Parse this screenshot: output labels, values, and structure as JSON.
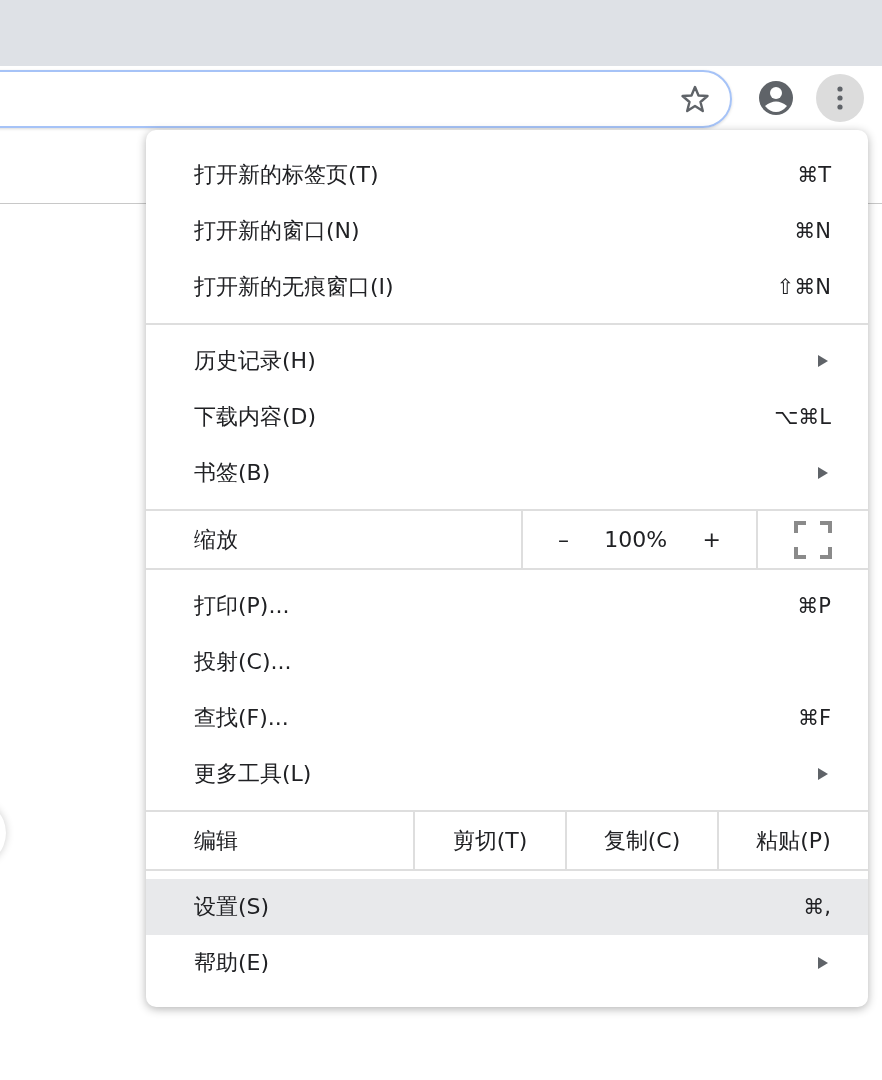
{
  "toolbar": {
    "address_bar": {
      "focused": true
    },
    "menu_button": {
      "pressed": true
    }
  },
  "menu": {
    "groups": [
      {
        "items": [
          {
            "kind": "item",
            "label": "打开新的标签页(T)",
            "shortcut": "⌘T",
            "submenu": false,
            "selected": false
          },
          {
            "kind": "item",
            "label": "打开新的窗口(N)",
            "shortcut": "⌘N",
            "submenu": false,
            "selected": false
          },
          {
            "kind": "item",
            "label": "打开新的无痕窗口(I)",
            "shortcut": "⇧⌘N",
            "submenu": false,
            "selected": false
          }
        ]
      },
      {
        "items": [
          {
            "kind": "item",
            "label": "历史记录(H)",
            "submenu": true,
            "selected": false
          },
          {
            "kind": "item",
            "label": "下载内容(D)",
            "shortcut": "⌥⌘L",
            "submenu": false,
            "selected": false
          },
          {
            "kind": "item",
            "label": "书签(B)",
            "submenu": true,
            "selected": false
          }
        ]
      },
      {
        "items": [
          {
            "kind": "zoom",
            "label": "缩放",
            "minus": "–",
            "value": "100%",
            "plus": "+"
          }
        ]
      },
      {
        "items": [
          {
            "kind": "item",
            "label": "打印(P)...",
            "shortcut": "⌘P",
            "submenu": false,
            "selected": false
          },
          {
            "kind": "item",
            "label": "投射(C)...",
            "submenu": false,
            "selected": false
          },
          {
            "kind": "item",
            "label": "查找(F)...",
            "shortcut": "⌘F",
            "submenu": false,
            "selected": false
          },
          {
            "kind": "item",
            "label": "更多工具(L)",
            "submenu": true,
            "selected": false
          }
        ]
      },
      {
        "items": [
          {
            "kind": "edit",
            "label": "编辑",
            "actions": [
              "剪切(T)",
              "复制(C)",
              "粘贴(P)"
            ]
          }
        ]
      },
      {
        "items": [
          {
            "kind": "item",
            "label": "设置(S)",
            "shortcut": "⌘,",
            "submenu": false,
            "selected": true
          },
          {
            "kind": "item",
            "label": "帮助(E)",
            "submenu": true,
            "selected": false
          }
        ]
      }
    ]
  }
}
